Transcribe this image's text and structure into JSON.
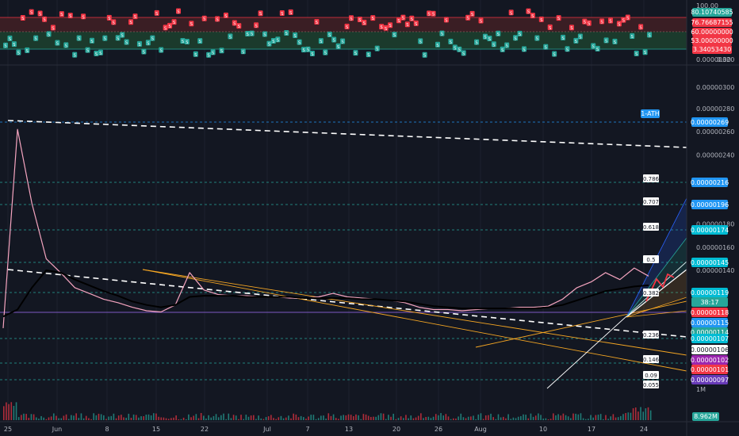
{
  "chart_data": [
    {
      "type": "line",
      "panel": "oscillator",
      "signal_marker": "S",
      "levels": [
        {
          "value": "80.10740585",
          "color": "#26a69a"
        },
        {
          "value": "76.76687155",
          "color": "#f23645"
        },
        {
          "value": "60.00000000",
          "color": "#f23645"
        },
        {
          "value": "53.00000000",
          "color": "#f23645"
        },
        {
          "value": "3.34053430",
          "color": "#f23645"
        }
      ],
      "ticks": [
        "100.00",
        "0.00"
      ],
      "overlap_ticks": [
        "0.00000320",
        "0.00000300"
      ]
    },
    {
      "type": "line",
      "panel": "price",
      "x_ticks": [
        "25",
        "Jun",
        "8",
        "15",
        "22",
        "Jul",
        "7",
        "13",
        "20",
        "26",
        "Aug",
        "10",
        "17",
        "24"
      ],
      "y_ticks": [
        "0.00000280",
        "0.00000260",
        "0.00000240",
        "0.00000180",
        "0.00000160",
        "0.00000140"
      ],
      "ath_label": "1-ATH",
      "price_levels": [
        {
          "value": "0.00000269",
          "bg": "#2196f3",
          "fg": "#ffffff",
          "line": "dashed"
        },
        {
          "value": "0.00000216",
          "bg": "#2196f3",
          "fg": "#ffffff",
          "line": "dashed"
        },
        {
          "value": "0.00000196",
          "bg": "#2196f3",
          "fg": "#ffffff",
          "line": "dashed"
        },
        {
          "value": "0.00000174",
          "bg": "#00bcd4",
          "fg": "#ffffff",
          "line": "dashed"
        },
        {
          "value": "0.00000145",
          "bg": "#00bcd4",
          "fg": "#ffffff",
          "line": "dashed"
        },
        {
          "value": "0.00000119",
          "bg": "#00bcd4",
          "fg": "#ffffff",
          "line": "dashed"
        },
        {
          "value": "38:17",
          "bg": "#26a69a",
          "fg": "#ffffff",
          "line": "none"
        },
        {
          "value": "0.00000118",
          "bg": "#f23645",
          "fg": "#ffffff",
          "line": "solid"
        },
        {
          "value": "0.00000115",
          "bg": "#2196f3",
          "fg": "#ffffff",
          "line": "none"
        },
        {
          "value": "0.00000114",
          "bg": "#26a69a",
          "fg": "#ffffff",
          "line": "none"
        },
        {
          "value": "0.00000107",
          "bg": "#00bcd4",
          "fg": "#ffffff",
          "line": "dashed"
        },
        {
          "value": "0.00000106",
          "bg": "#ffffff",
          "fg": "#131722",
          "line": "none"
        },
        {
          "value": "0.00000102",
          "bg": "#9c27b0",
          "fg": "#ffffff",
          "line": "none"
        },
        {
          "value": "0.00000101",
          "bg": "#f23645",
          "fg": "#ffffff",
          "line": "none"
        },
        {
          "value": "0.00000097",
          "bg": "#673ab7",
          "fg": "#ffffff",
          "line": "none"
        }
      ],
      "fib_levels": [
        {
          "label": "0.786",
          "value": 2.16e-06
        },
        {
          "label": "0.707",
          "value": 1.96e-06
        },
        {
          "label": "0.618",
          "value": 1.74e-06
        },
        {
          "label": "0.5",
          "value": 1.45e-06
        },
        {
          "label": "0.382",
          "value": 1.19e-06
        },
        {
          "label": "0.236",
          "value": 1.07e-06
        },
        {
          "label": "0.146",
          "value": 9.9e-07
        },
        {
          "label": "0.09",
          "value": 9.4e-07
        },
        {
          "label": "0.055",
          "value": 9.2e-07
        }
      ],
      "series": [
        {
          "name": "",
          "color": "#f6a5c0",
          "values": [
            9e-07,
            2.62e-06,
            1.98e-06,
            1.5e-06,
            1.38e-06,
            1.25e-06,
            1.2e-06,
            1.15e-06,
            1.12e-06,
            1.08e-06,
            1.05e-06,
            1.04e-06,
            1.1e-06,
            1.38e-06,
            1.23e-06,
            1.19e-06,
            1.18e-06,
            1.18e-06,
            1.17e-06,
            1.17e-06,
            1.16e-06,
            1.16e-06,
            1.17e-06,
            1.2e-06,
            1.17e-06,
            1.16e-06,
            1.15e-06,
            1.14e-06,
            1.12e-06,
            1.08e-06,
            1.06e-06,
            1.06e-06,
            1.05e-06,
            1.06e-06,
            1.07e-06,
            1.07e-06,
            1.08e-06,
            1.08e-06,
            1.09e-06,
            1.15e-06,
            1.25e-06,
            1.3e-06,
            1.38e-06,
            1.32e-06,
            1.42e-06,
            1.35e-06
          ]
        },
        {
          "name": "",
          "color": "#000000",
          "values": [
            1e-06,
            1.06e-06,
            1.25e-06,
            1.4e-06,
            1.38e-06,
            1.32e-06,
            1.27e-06,
            1.22e-06,
            1.18e-06,
            1.13e-06,
            1.1e-06,
            1.08e-06,
            1.1e-06,
            1.17e-06,
            1.18e-06,
            1.18e-06,
            1.18e-06,
            1.17e-06,
            1.17e-06,
            1.17e-06,
            1.17e-06,
            1.16e-06,
            1.16e-06,
            1.16e-06,
            1.16e-06,
            1.15e-06,
            1.15e-06,
            1.14e-06,
            1.13e-06,
            1.11e-06,
            1.09e-06,
            1.08e-06,
            1.07e-06,
            1.07e-06,
            1.07e-06,
            1.07e-06,
            1.07e-06,
            1.07e-06,
            1.08e-06,
            1.1e-06,
            1.14e-06,
            1.18e-06,
            1.22e-06,
            1.24e-06,
            1.26e-06,
            1.27e-06
          ]
        }
      ]
    },
    {
      "type": "bar",
      "panel": "volume",
      "y_ticks": [
        "1M"
      ],
      "badge": {
        "value": "8.962M",
        "bg": "#26a69a",
        "fg": "#ffffff"
      }
    }
  ]
}
